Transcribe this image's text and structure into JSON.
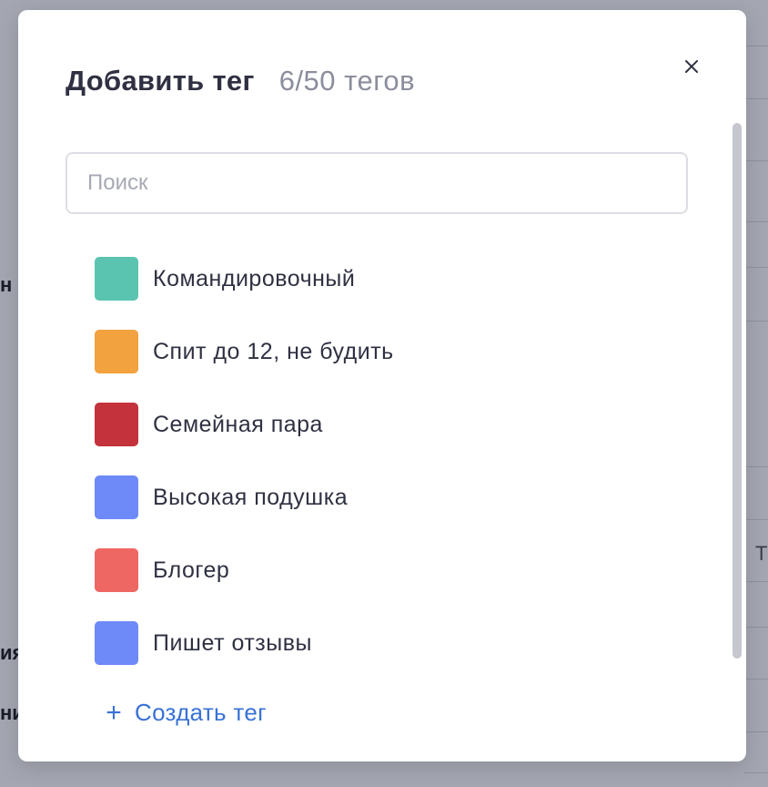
{
  "modal": {
    "title": "Добавить тег",
    "count": "6/50 тегов",
    "search": {
      "placeholder": "Поиск",
      "value": ""
    },
    "tags": [
      {
        "label": "Командировочный",
        "color": "#5bc4b0"
      },
      {
        "label": "Спит до 12, не будить",
        "color": "#f2a23e"
      },
      {
        "label": "Семейная пара",
        "color": "#c4323c"
      },
      {
        "label": "Высокая подушка",
        "color": "#6e8af8"
      },
      {
        "label": "Блогер",
        "color": "#ee6763"
      },
      {
        "label": "Пишет отзывы",
        "color": "#6e8af8"
      }
    ],
    "create_label": "Создать тег",
    "create_icon": "plus-icon",
    "close_icon": "close-icon"
  },
  "background": {
    "left_fragments": [
      "н",
      "ия",
      "ни"
    ],
    "right_fragments": [
      "Т"
    ]
  },
  "colors": {
    "accent": "#3872d6",
    "overlay": "#a4a6b1"
  }
}
